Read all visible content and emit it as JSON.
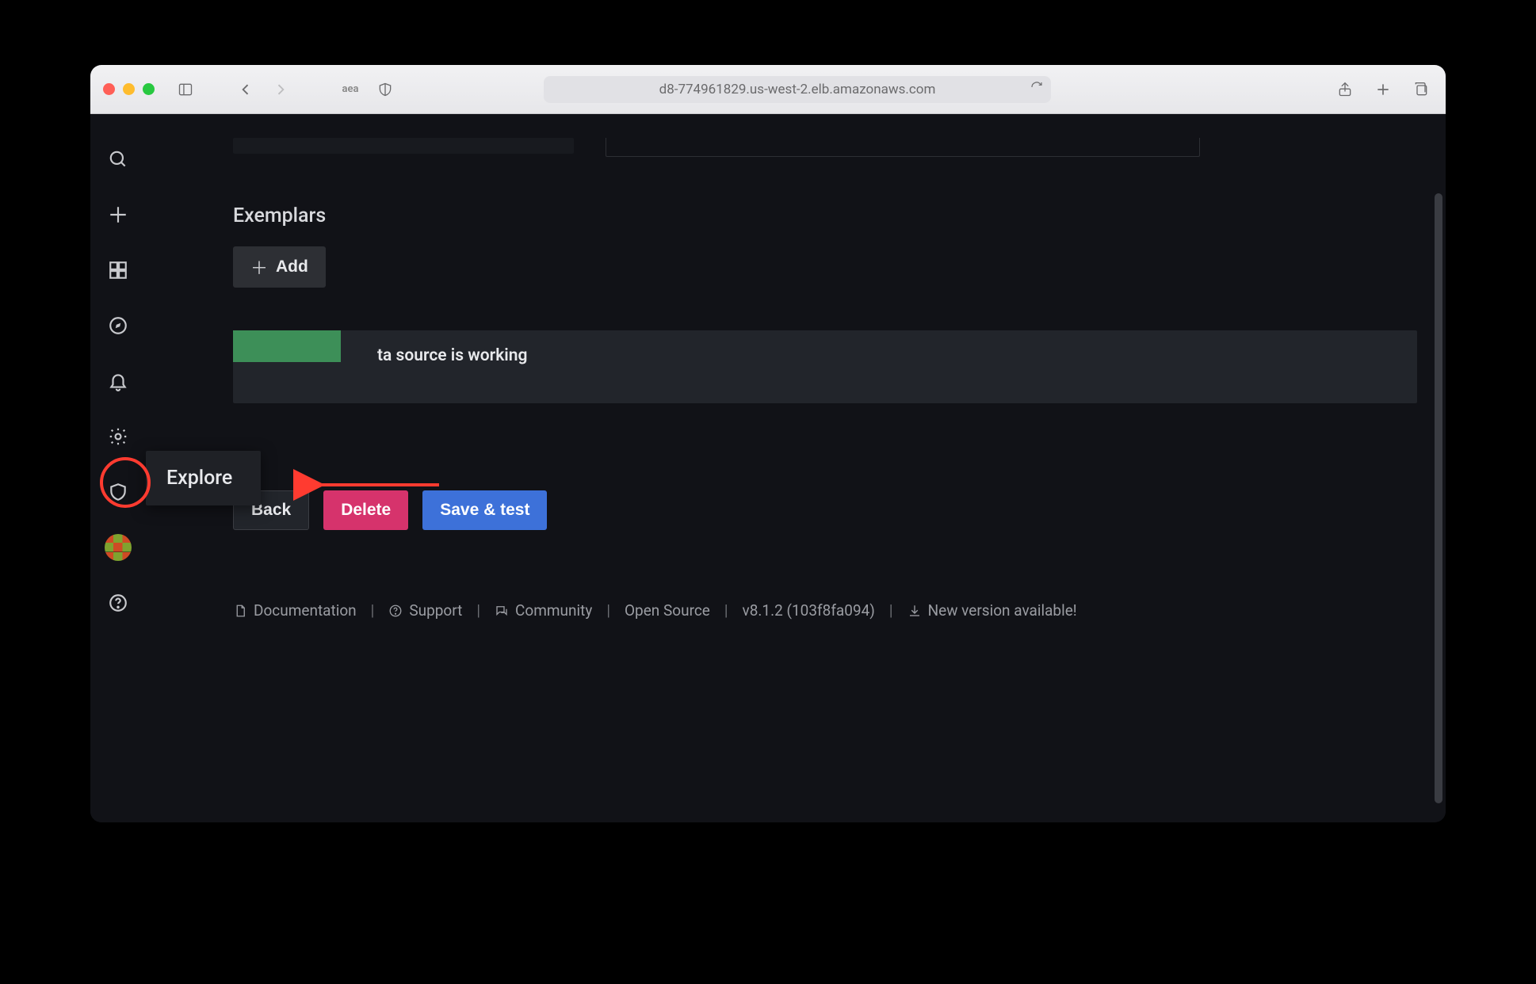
{
  "browser": {
    "url": "d8-774961829.us-west-2.elb.amazonaws.com",
    "extension_label": "aea"
  },
  "sidebar": {
    "tooltip": "Explore"
  },
  "exemplars": {
    "title": "Exemplars",
    "add_label": "Add"
  },
  "status": {
    "message": "ta source is working"
  },
  "actions": {
    "back": "Back",
    "delete": "Delete",
    "save_test": "Save & test"
  },
  "footer": {
    "documentation": "Documentation",
    "support": "Support",
    "community": "Community",
    "open_source": "Open Source",
    "version": "v8.1.2 (103f8fa094)",
    "new_version": "New version available!"
  }
}
